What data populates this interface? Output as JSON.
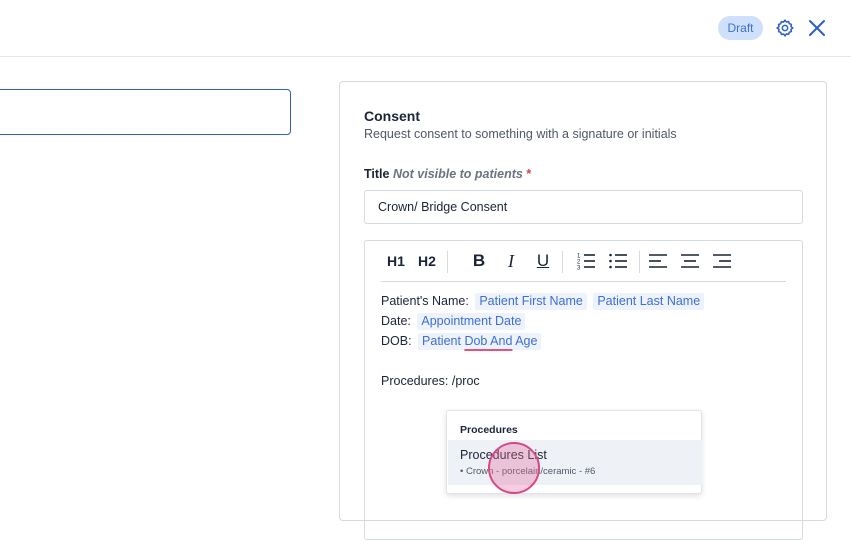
{
  "header": {
    "status_badge": "Draft",
    "icons": {
      "settings": "gear-icon",
      "close": "close-icon"
    },
    "colors": {
      "badge_bg": "#cfe0fb",
      "badge_text": "#3d6fd6",
      "accent": "#2f5fc4"
    }
  },
  "left_panel": {
    "input_value": ""
  },
  "card": {
    "title": "Consent",
    "subtitle": "Request consent to something with a signature or initials",
    "title_field": {
      "label": "Title",
      "hint": "Not visible to patients",
      "required_mark": "*",
      "value": "Crown/ Bridge Consent"
    },
    "toolbar": {
      "h1": "H1",
      "h2": "H2",
      "bold": "B",
      "italic": "I",
      "underline": "U"
    },
    "editor": {
      "line1_label": "Patient's Name:",
      "line1_tags": [
        "Patient First Name",
        "Patient Last Name"
      ],
      "line2_label": "Date:",
      "line2_tag": "Appointment Date",
      "line3_label": "DOB:",
      "line3_tag_a": "Patient",
      "line3_tag_b": "Dob And",
      "line3_tag_c": "Age",
      "line4": "Procedures: /proc"
    },
    "dropdown": {
      "heading": "Procedures",
      "item_title": "Procedures List",
      "item_sub": "• Crown - porcelain/ceramic - #6"
    }
  }
}
